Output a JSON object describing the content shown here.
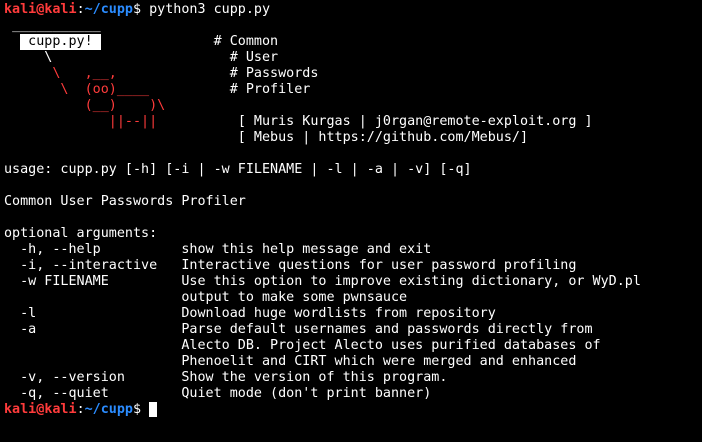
{
  "prompt": {
    "user": "kali",
    "at": "@",
    "host": "kali",
    "colon": ":",
    "path": "~/cupp",
    "symbol": "$"
  },
  "command": "python3 cupp.py",
  "banner": {
    "underline": "___________",
    "box_label": " cupp.py! ",
    "art": {
      "l3": "     \\",
      "l4": "      \\   ,__,",
      "l5": "       \\  (oo)____",
      "l6": "          (__)    )\\",
      "l7": "             ||--|| "
    },
    "right": {
      "l2": "# Common",
      "l3": "# User",
      "l4": "# Passwords",
      "l5": "# Profiler",
      "l7": "[ Muris Kurgas | j0rgan@remote-exploit.org ]",
      "l8": "[ Mebus | https://github.com/Mebus/]"
    }
  },
  "usage": "usage: cupp.py [-h] [-i | -w FILENAME | -l | -a | -v] [-q]",
  "description": "Common User Passwords Profiler",
  "optional_header": "optional arguments:",
  "options": [
    {
      "flag": "  -h, --help          ",
      "desc": "show this help message and exit"
    },
    {
      "flag": "  -i, --interactive   ",
      "desc": "Interactive questions for user password profiling"
    },
    {
      "flag": "  -w FILENAME         ",
      "desc": "Use this option to improve existing dictionary, or WyD.pl"
    },
    {
      "flag": "                      ",
      "desc": "output to make some pwnsauce"
    },
    {
      "flag": "  -l                  ",
      "desc": "Download huge wordlists from repository"
    },
    {
      "flag": "  -a                  ",
      "desc": "Parse default usernames and passwords directly from"
    },
    {
      "flag": "                      ",
      "desc": "Alecto DB. Project Alecto uses purified databases of"
    },
    {
      "flag": "                      ",
      "desc": "Phenoelit and CIRT which were merged and enhanced"
    },
    {
      "flag": "  -v, --version       ",
      "desc": "Show the version of this program."
    },
    {
      "flag": "  -q, --quiet         ",
      "desc": "Quiet mode (don't print banner)"
    }
  ],
  "colors": {
    "background": "#000000",
    "text": "#ffffff",
    "prompt_red": "#ff3b3b",
    "prompt_blue": "#2b8cff"
  }
}
